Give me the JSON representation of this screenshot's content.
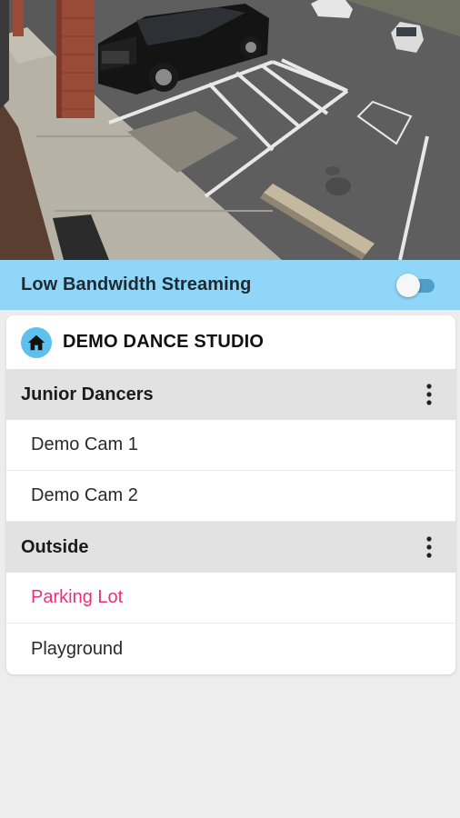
{
  "bandwidth": {
    "label": "Low Bandwidth Streaming",
    "enabled": false
  },
  "site": {
    "name": "DEMO DANCE STUDIO",
    "icon": "home-icon"
  },
  "groups": [
    {
      "label": "Junior Dancers",
      "menu_icon": "more-vertical-icon",
      "cameras": [
        {
          "label": "Demo Cam 1",
          "selected": false
        },
        {
          "label": "Demo Cam 2",
          "selected": false
        }
      ]
    },
    {
      "label": "Outside",
      "menu_icon": "more-vertical-icon",
      "cameras": [
        {
          "label": "Parking Lot",
          "selected": true
        },
        {
          "label": "Playground",
          "selected": false
        }
      ]
    }
  ],
  "colors": {
    "accent_bar": "#8fd6f8",
    "home_badge": "#5ec0ef",
    "selected_text": "#e9317d",
    "group_bg": "#e2e2e2"
  }
}
